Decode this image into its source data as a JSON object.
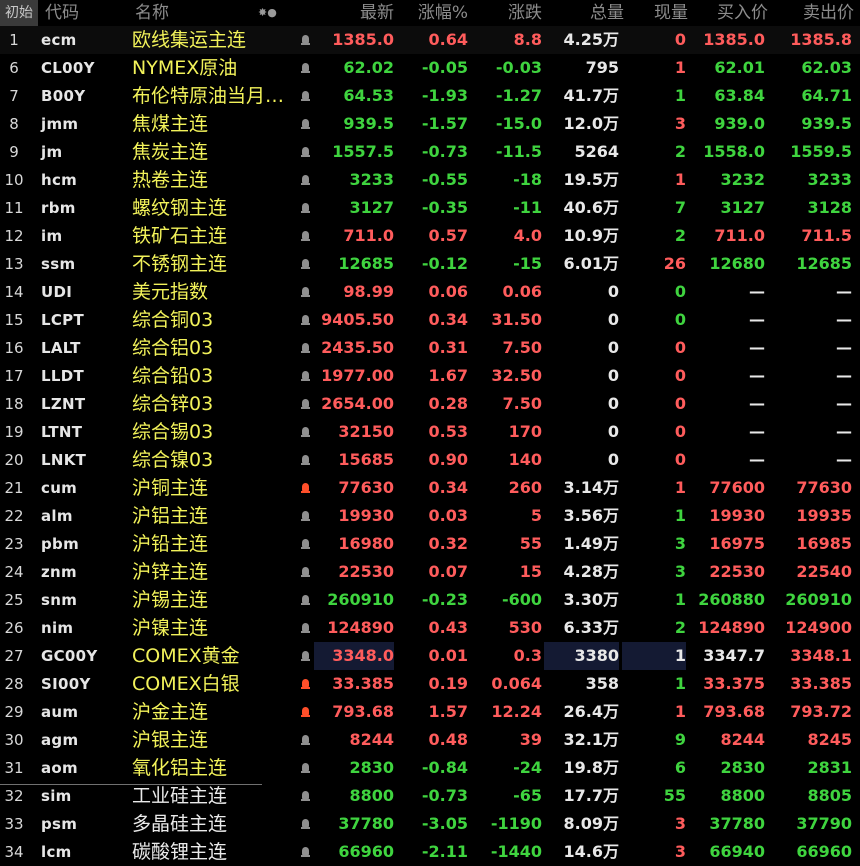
{
  "header": {
    "badge": "初始",
    "code": "代码",
    "name": "名称",
    "sort_icons": "✸●",
    "last": "最新",
    "pct": "涨幅%",
    "chg": "涨跌",
    "vol": "总量",
    "cur": "现量",
    "bid": "买入价",
    "ask": "卖出价"
  },
  "colors": {
    "background": "#000000",
    "up": "#ff5c5c",
    "down": "#3fd43f",
    "name_yellow": "#f2f25a",
    "alert_bell": "#ff4f2a",
    "highlight": "#141a33"
  },
  "rows": [
    {
      "idx": "1",
      "code": "ecm",
      "name": "欧线集运主连",
      "bell": "off",
      "last": "1385.0",
      "pct": "0.64",
      "chg": "8.8",
      "vol": "4.25万",
      "cur": "0",
      "bid": "1385.0",
      "ask": "1385.8",
      "last_c": "up",
      "pct_c": "up",
      "chg_c": "up",
      "cur_c": "up",
      "bid_c": "up",
      "ask_c": "up",
      "name_c": "nm-yellow"
    },
    {
      "idx": "6",
      "code": "CL00Y",
      "name": "NYMEX原油",
      "bell": "off",
      "last": "62.02",
      "pct": "-0.05",
      "chg": "-0.03",
      "vol": "795",
      "cur": "1",
      "bid": "62.01",
      "ask": "62.03",
      "last_c": "down",
      "pct_c": "down",
      "chg_c": "down",
      "cur_c": "up",
      "bid_c": "down",
      "ask_c": "down",
      "name_c": "nm-yellow"
    },
    {
      "idx": "7",
      "code": "B00Y",
      "name": "布伦特原油当月连续",
      "bell": "off",
      "last": "64.53",
      "pct": "-1.93",
      "chg": "-1.27",
      "vol": "41.7万",
      "cur": "1",
      "bid": "63.84",
      "ask": "64.71",
      "last_c": "down",
      "pct_c": "down",
      "chg_c": "down",
      "cur_c": "down",
      "bid_c": "down",
      "ask_c": "down",
      "name_c": "nm-yellow"
    },
    {
      "idx": "8",
      "code": "jmm",
      "name": "焦煤主连",
      "bell": "off",
      "last": "939.5",
      "pct": "-1.57",
      "chg": "-15.0",
      "vol": "12.0万",
      "cur": "3",
      "bid": "939.0",
      "ask": "939.5",
      "last_c": "down",
      "pct_c": "down",
      "chg_c": "down",
      "cur_c": "up",
      "bid_c": "down",
      "ask_c": "down",
      "name_c": "nm-yellow"
    },
    {
      "idx": "9",
      "code": "jm",
      "name": "焦炭主连",
      "bell": "off",
      "last": "1557.5",
      "pct": "-0.73",
      "chg": "-11.5",
      "vol": "5264",
      "cur": "2",
      "bid": "1558.0",
      "ask": "1559.5",
      "last_c": "down",
      "pct_c": "down",
      "chg_c": "down",
      "cur_c": "down",
      "bid_c": "down",
      "ask_c": "down",
      "name_c": "nm-yellow"
    },
    {
      "idx": "10",
      "code": "hcm",
      "name": "热卷主连",
      "bell": "off",
      "last": "3233",
      "pct": "-0.55",
      "chg": "-18",
      "vol": "19.5万",
      "cur": "1",
      "bid": "3232",
      "ask": "3233",
      "last_c": "down",
      "pct_c": "down",
      "chg_c": "down",
      "cur_c": "up",
      "bid_c": "down",
      "ask_c": "down",
      "name_c": "nm-yellow"
    },
    {
      "idx": "11",
      "code": "rbm",
      "name": "螺纹钢主连",
      "bell": "off",
      "last": "3127",
      "pct": "-0.35",
      "chg": "-11",
      "vol": "40.6万",
      "cur": "7",
      "bid": "3127",
      "ask": "3128",
      "last_c": "down",
      "pct_c": "down",
      "chg_c": "down",
      "cur_c": "down",
      "bid_c": "down",
      "ask_c": "down",
      "name_c": "nm-yellow"
    },
    {
      "idx": "12",
      "code": "im",
      "name": "铁矿石主连",
      "bell": "off",
      "last": "711.0",
      "pct": "0.57",
      "chg": "4.0",
      "vol": "10.9万",
      "cur": "2",
      "bid": "711.0",
      "ask": "711.5",
      "last_c": "up",
      "pct_c": "up",
      "chg_c": "up",
      "cur_c": "down",
      "bid_c": "up",
      "ask_c": "up",
      "name_c": "nm-yellow"
    },
    {
      "idx": "13",
      "code": "ssm",
      "name": "不锈钢主连",
      "bell": "off",
      "last": "12685",
      "pct": "-0.12",
      "chg": "-15",
      "vol": "6.01万",
      "cur": "26",
      "bid": "12680",
      "ask": "12685",
      "last_c": "down",
      "pct_c": "down",
      "chg_c": "down",
      "cur_c": "up",
      "bid_c": "down",
      "ask_c": "down",
      "name_c": "nm-yellow"
    },
    {
      "idx": "14",
      "code": "UDI",
      "name": "美元指数",
      "bell": "off",
      "last": "98.99",
      "pct": "0.06",
      "chg": "0.06",
      "vol": "0",
      "cur": "0",
      "bid": "—",
      "ask": "—",
      "last_c": "up",
      "pct_c": "up",
      "chg_c": "up",
      "cur_c": "down",
      "bid_c": "flat",
      "ask_c": "flat",
      "name_c": "nm-yellow"
    },
    {
      "idx": "15",
      "code": "LCPT",
      "name": "综合铜03",
      "bell": "off",
      "last": "9405.50",
      "pct": "0.34",
      "chg": "31.50",
      "vol": "0",
      "cur": "0",
      "bid": "—",
      "ask": "—",
      "last_c": "up",
      "pct_c": "up",
      "chg_c": "up",
      "cur_c": "down",
      "bid_c": "flat",
      "ask_c": "flat",
      "name_c": "nm-yellow"
    },
    {
      "idx": "16",
      "code": "LALT",
      "name": "综合铝03",
      "bell": "off",
      "last": "2435.50",
      "pct": "0.31",
      "chg": "7.50",
      "vol": "0",
      "cur": "0",
      "bid": "—",
      "ask": "—",
      "last_c": "up",
      "pct_c": "up",
      "chg_c": "up",
      "cur_c": "up",
      "bid_c": "flat",
      "ask_c": "flat",
      "name_c": "nm-yellow"
    },
    {
      "idx": "17",
      "code": "LLDT",
      "name": "综合铅03",
      "bell": "off",
      "last": "1977.00",
      "pct": "1.67",
      "chg": "32.50",
      "vol": "0",
      "cur": "0",
      "bid": "—",
      "ask": "—",
      "last_c": "up",
      "pct_c": "up",
      "chg_c": "up",
      "cur_c": "up",
      "bid_c": "flat",
      "ask_c": "flat",
      "name_c": "nm-yellow"
    },
    {
      "idx": "18",
      "code": "LZNT",
      "name": "综合锌03",
      "bell": "off",
      "last": "2654.00",
      "pct": "0.28",
      "chg": "7.50",
      "vol": "0",
      "cur": "0",
      "bid": "—",
      "ask": "—",
      "last_c": "up",
      "pct_c": "up",
      "chg_c": "up",
      "cur_c": "up",
      "bid_c": "flat",
      "ask_c": "flat",
      "name_c": "nm-yellow"
    },
    {
      "idx": "19",
      "code": "LTNT",
      "name": "综合锡03",
      "bell": "off",
      "last": "32150",
      "pct": "0.53",
      "chg": "170",
      "vol": "0",
      "cur": "0",
      "bid": "—",
      "ask": "—",
      "last_c": "up",
      "pct_c": "up",
      "chg_c": "up",
      "cur_c": "up",
      "bid_c": "flat",
      "ask_c": "flat",
      "name_c": "nm-yellow"
    },
    {
      "idx": "20",
      "code": "LNKT",
      "name": "综合镍03",
      "bell": "off",
      "last": "15685",
      "pct": "0.90",
      "chg": "140",
      "vol": "0",
      "cur": "0",
      "bid": "—",
      "ask": "—",
      "last_c": "up",
      "pct_c": "up",
      "chg_c": "up",
      "cur_c": "up",
      "bid_c": "flat",
      "ask_c": "flat",
      "name_c": "nm-yellow"
    },
    {
      "idx": "21",
      "code": "cum",
      "name": "沪铜主连",
      "bell": "on",
      "last": "77630",
      "pct": "0.34",
      "chg": "260",
      "vol": "3.14万",
      "cur": "1",
      "bid": "77600",
      "ask": "77630",
      "last_c": "up",
      "pct_c": "up",
      "chg_c": "up",
      "cur_c": "up",
      "bid_c": "up",
      "ask_c": "up",
      "name_c": "nm-yellow"
    },
    {
      "idx": "22",
      "code": "alm",
      "name": "沪铝主连",
      "bell": "off",
      "last": "19930",
      "pct": "0.03",
      "chg": "5",
      "vol": "3.56万",
      "cur": "1",
      "bid": "19930",
      "ask": "19935",
      "last_c": "up",
      "pct_c": "up",
      "chg_c": "up",
      "cur_c": "down",
      "bid_c": "up",
      "ask_c": "up",
      "name_c": "nm-yellow"
    },
    {
      "idx": "23",
      "code": "pbm",
      "name": "沪铅主连",
      "bell": "off",
      "last": "16980",
      "pct": "0.32",
      "chg": "55",
      "vol": "1.49万",
      "cur": "3",
      "bid": "16975",
      "ask": "16985",
      "last_c": "up",
      "pct_c": "up",
      "chg_c": "up",
      "cur_c": "down",
      "bid_c": "up",
      "ask_c": "up",
      "name_c": "nm-yellow"
    },
    {
      "idx": "24",
      "code": "znm",
      "name": "沪锌主连",
      "bell": "off",
      "last": "22530",
      "pct": "0.07",
      "chg": "15",
      "vol": "4.28万",
      "cur": "3",
      "bid": "22530",
      "ask": "22540",
      "last_c": "up",
      "pct_c": "up",
      "chg_c": "up",
      "cur_c": "down",
      "bid_c": "up",
      "ask_c": "up",
      "name_c": "nm-yellow"
    },
    {
      "idx": "25",
      "code": "snm",
      "name": "沪锡主连",
      "bell": "off",
      "last": "260910",
      "pct": "-0.23",
      "chg": "-600",
      "vol": "3.30万",
      "cur": "1",
      "bid": "260880",
      "ask": "260910",
      "last_c": "down",
      "pct_c": "down",
      "chg_c": "down",
      "cur_c": "down",
      "bid_c": "down",
      "ask_c": "down",
      "name_c": "nm-yellow"
    },
    {
      "idx": "26",
      "code": "nim",
      "name": "沪镍主连",
      "bell": "off",
      "last": "124890",
      "pct": "0.43",
      "chg": "530",
      "vol": "6.33万",
      "cur": "2",
      "bid": "124890",
      "ask": "124900",
      "last_c": "up",
      "pct_c": "up",
      "chg_c": "up",
      "cur_c": "down",
      "bid_c": "up",
      "ask_c": "up",
      "name_c": "nm-yellow"
    },
    {
      "idx": "27",
      "code": "GC00Y",
      "name": "COMEX黄金",
      "bell": "off",
      "last": "3348.0",
      "pct": "0.01",
      "chg": "0.3",
      "vol": "3380",
      "cur": "1",
      "bid": "3347.7",
      "ask": "3348.1",
      "last_c": "up",
      "pct_c": "up",
      "chg_c": "up",
      "cur_c": "flat",
      "bid_c": "flat",
      "ask_c": "up",
      "name_c": "nm-yellow",
      "hl": true
    },
    {
      "idx": "28",
      "code": "SI00Y",
      "name": "COMEX白银",
      "bell": "on",
      "last": "33.385",
      "pct": "0.19",
      "chg": "0.064",
      "vol": "358",
      "cur": "1",
      "bid": "33.375",
      "ask": "33.385",
      "last_c": "up",
      "pct_c": "up",
      "chg_c": "up",
      "cur_c": "down",
      "bid_c": "up",
      "ask_c": "up",
      "name_c": "nm-yellow"
    },
    {
      "idx": "29",
      "code": "aum",
      "name": "沪金主连",
      "bell": "on",
      "last": "793.68",
      "pct": "1.57",
      "chg": "12.24",
      "vol": "26.4万",
      "cur": "1",
      "bid": "793.68",
      "ask": "793.72",
      "last_c": "up",
      "pct_c": "up",
      "chg_c": "up",
      "cur_c": "up",
      "bid_c": "up",
      "ask_c": "up",
      "name_c": "nm-yellow"
    },
    {
      "idx": "30",
      "code": "agm",
      "name": "沪银主连",
      "bell": "off",
      "last": "8244",
      "pct": "0.48",
      "chg": "39",
      "vol": "32.1万",
      "cur": "9",
      "bid": "8244",
      "ask": "8245",
      "last_c": "up",
      "pct_c": "up",
      "chg_c": "up",
      "cur_c": "down",
      "bid_c": "up",
      "ask_c": "up",
      "name_c": "nm-yellow"
    },
    {
      "idx": "31",
      "code": "aom",
      "name": "氧化铝主连",
      "bell": "off",
      "last": "2830",
      "pct": "-0.84",
      "chg": "-24",
      "vol": "19.8万",
      "cur": "6",
      "bid": "2830",
      "ask": "2831",
      "last_c": "down",
      "pct_c": "down",
      "chg_c": "down",
      "cur_c": "down",
      "bid_c": "down",
      "ask_c": "down",
      "name_c": "nm-yellow"
    },
    {
      "idx": "32",
      "code": "sim",
      "name": "工业硅主连",
      "bell": "off",
      "last": "8800",
      "pct": "-0.73",
      "chg": "-65",
      "vol": "17.7万",
      "cur": "55",
      "bid": "8800",
      "ask": "8805",
      "last_c": "down",
      "pct_c": "down",
      "chg_c": "down",
      "cur_c": "down",
      "bid_c": "down",
      "ask_c": "down",
      "name_c": "nm-white"
    },
    {
      "idx": "33",
      "code": "psm",
      "name": "多晶硅主连",
      "bell": "off",
      "last": "37780",
      "pct": "-3.05",
      "chg": "-1190",
      "vol": "8.09万",
      "cur": "3",
      "bid": "37780",
      "ask": "37790",
      "last_c": "down",
      "pct_c": "down",
      "chg_c": "down",
      "cur_c": "up",
      "bid_c": "down",
      "ask_c": "down",
      "name_c": "nm-white"
    },
    {
      "idx": "34",
      "code": "lcm",
      "name": "碳酸锂主连",
      "bell": "off",
      "last": "66960",
      "pct": "-2.11",
      "chg": "-1440",
      "vol": "14.6万",
      "cur": "3",
      "bid": "66940",
      "ask": "66960",
      "last_c": "down",
      "pct_c": "down",
      "chg_c": "down",
      "cur_c": "up",
      "bid_c": "down",
      "ask_c": "down",
      "name_c": "nm-white"
    }
  ]
}
